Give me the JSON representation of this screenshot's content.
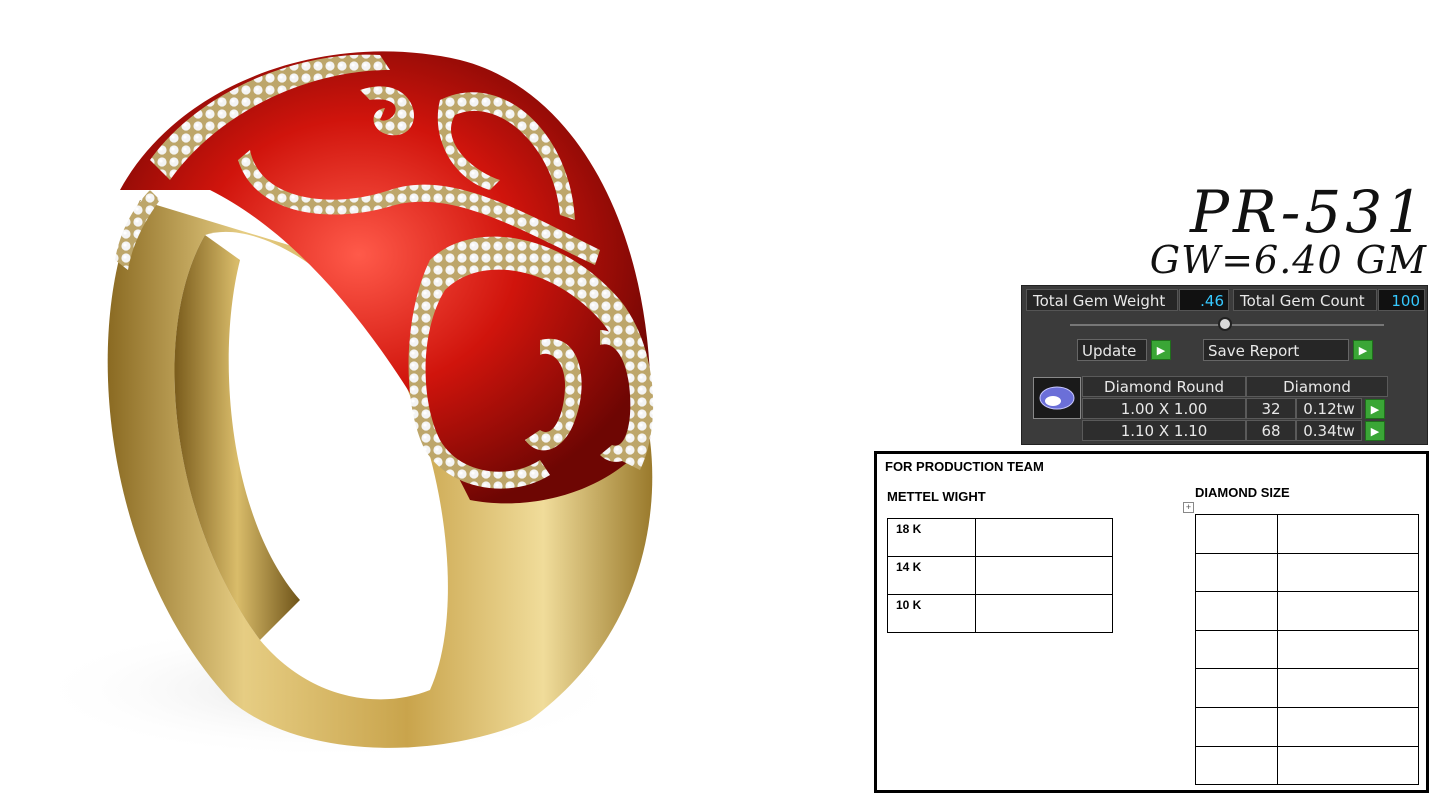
{
  "colors": {
    "gold": "#d4b25a",
    "enamel_red": "#c4140e",
    "panel_bg": "#3b3b3b",
    "value_text": "#36c9ff",
    "go_button": "#3aa636"
  },
  "product": {
    "model": "PR-531",
    "gross_weight": "GW=6.40 GM"
  },
  "gem_panel": {
    "total_gem_weight_label": "Total Gem Weight",
    "total_gem_weight_value": ".46",
    "total_gem_count_label": "Total Gem Count",
    "total_gem_count_value": "100",
    "update_label": "Update",
    "save_report_label": "Save Report",
    "table": {
      "header_shape": "Diamond Round",
      "header_type": "Diamond",
      "rows": [
        {
          "size": "1.00 X 1.00",
          "count": "32",
          "weight": "0.12tw"
        },
        {
          "size": "1.10 X 1.10",
          "count": "68",
          "weight": "0.34tw"
        }
      ]
    }
  },
  "production_form": {
    "heading": "FOR PRODUCTION TEAM",
    "metal_heading": "METTEL WIGHT",
    "diamond_heading": "DIAMOND SIZE",
    "metal_rows": [
      {
        "karat": "18 K",
        "value": ""
      },
      {
        "karat": "14 K",
        "value": ""
      },
      {
        "karat": "10 K",
        "value": ""
      }
    ],
    "diamond_row_count": 7
  }
}
